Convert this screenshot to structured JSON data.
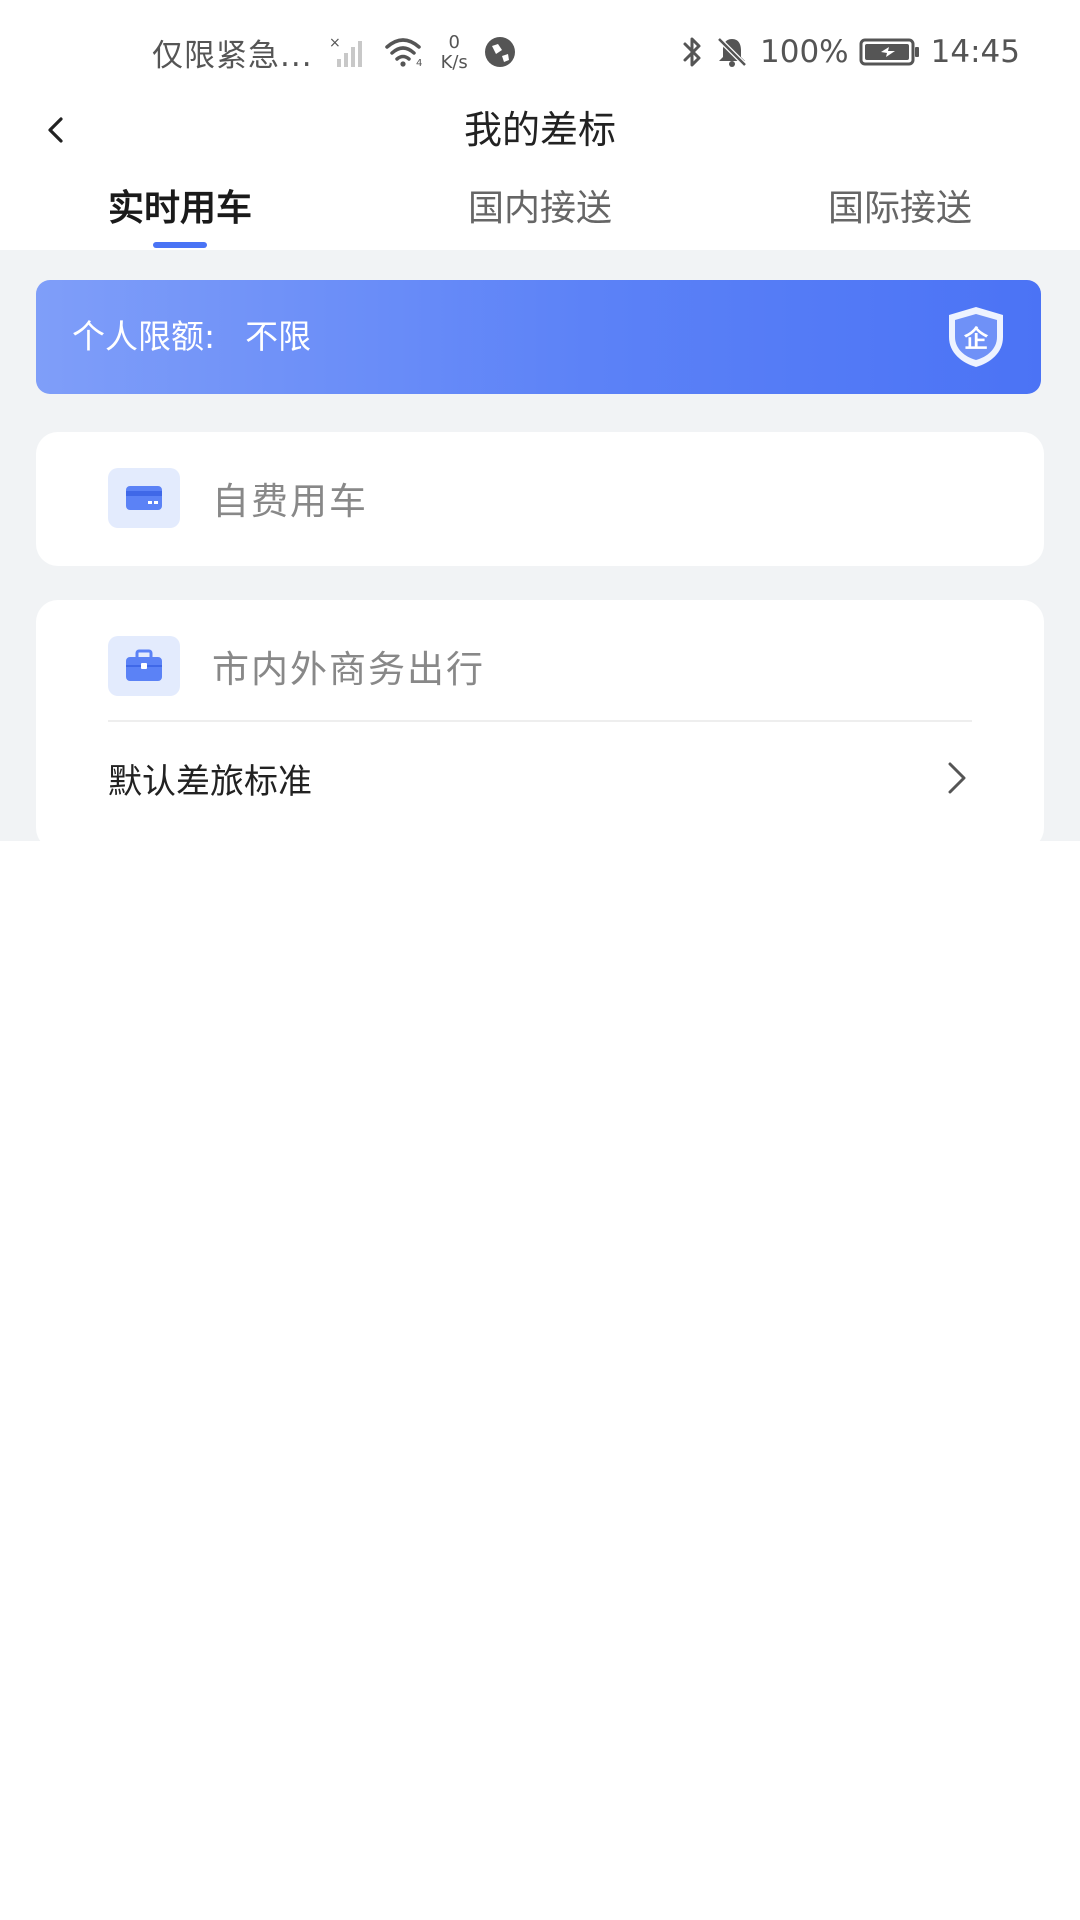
{
  "status_bar": {
    "carrier_text": "仅限紧急...",
    "net_speed_value": "0",
    "net_speed_unit": "K/s",
    "battery_percent": "100%",
    "time": "14:45"
  },
  "nav": {
    "title": "我的差标"
  },
  "tabs": [
    {
      "label": "实时用车",
      "active": true
    },
    {
      "label": "国内接送",
      "active": false
    },
    {
      "label": "国际接送",
      "active": false
    }
  ],
  "limit_banner": {
    "label": "个人限额:",
    "value": "不限",
    "badge_text": "企"
  },
  "self_pay_card": {
    "title": "自费用车",
    "icon": "credit-card-icon"
  },
  "business_card": {
    "title": "市内外商务出行",
    "icon": "briefcase-icon",
    "row_label": "默认差旅标准"
  },
  "colors": {
    "accent": "#4a74f5",
    "banner_start": "#7f9ef9",
    "banner_end": "#4b73f5",
    "page_bg": "#f1f3f5",
    "icon_tile_bg": "#e3ebfd"
  }
}
